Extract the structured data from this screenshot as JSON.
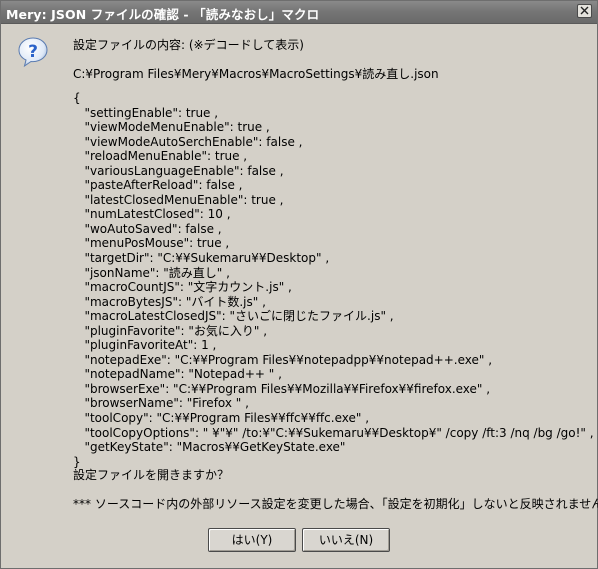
{
  "window": {
    "title": "Mery: JSON ファイルの確認 - 「読みなおし」マクロ",
    "close_icon": "close-icon"
  },
  "dialog": {
    "icon": "question-icon",
    "heading": "設定ファイルの内容: (※デコードして表示)",
    "filepath": "C:¥Program Files¥Mery¥Macros¥MacroSettings¥読み直し.json",
    "json_lines": [
      "{",
      "   \"settingEnable\": true ,",
      "   \"viewModeMenuEnable\": true ,",
      "   \"viewModeAutoSerchEnable\": false ,",
      "   \"reloadMenuEnable\": true ,",
      "   \"variousLanguageEnable\": false ,",
      "   \"pasteAfterReload\": false ,",
      "   \"latestClosedMenuEnable\": true ,",
      "   \"numLatestClosed\": 10 ,",
      "   \"woAutoSaved\": false ,",
      "   \"menuPosMouse\": true ,",
      "   \"targetDir\": \"C:¥¥Sukemaru¥¥Desktop\" ,",
      "   \"jsonName\": \"読み直し\" ,",
      "   \"macroCountJS\": \"文字カウント.js\" ,",
      "   \"macroBytesJS\": \"バイト数.js\" ,",
      "   \"macroLatestClosedJS\": \"さいごに閉じたファイル.js\" ,",
      "   \"pluginFavorite\": \"お気に入り\" ,",
      "   \"pluginFavoriteAt\": 1 ,",
      "   \"notepadExe\": \"C:¥¥Program Files¥¥notepadpp¥¥notepad++.exe\" ,",
      "   \"notepadName\": \"Notepad++ \" ,",
      "   \"browserExe\": \"C:¥¥Program Files¥¥Mozilla¥¥Firefox¥¥firefox.exe\" ,",
      "   \"browserName\": \"Firefox \" ,",
      "   \"toolCopy\": \"C:¥¥Program Files¥¥ffc¥¥ffc.exe\" ,",
      "   \"toolCopyOptions\": \" ¥\"¥\" /to:¥\"C:¥¥Sukemaru¥¥Desktop¥\" /copy /ft:3 /nq /bg /go!\" ,",
      "   \"getKeyState\": \"Macros¥¥GetKeyState.exe\"",
      "}"
    ],
    "question": "設定ファイルを開きますか？",
    "note": "*** ソースコード内の外部リソース設定を変更した場合、「設定を初期化」しないと反映されません ***",
    "buttons": {
      "yes": "はい(Y)",
      "no": "いいえ(N)"
    }
  },
  "colors": {
    "titlebar": "#767676",
    "dialog_bg": "#d4d0c8",
    "icon_blue": "#2a62c9"
  }
}
